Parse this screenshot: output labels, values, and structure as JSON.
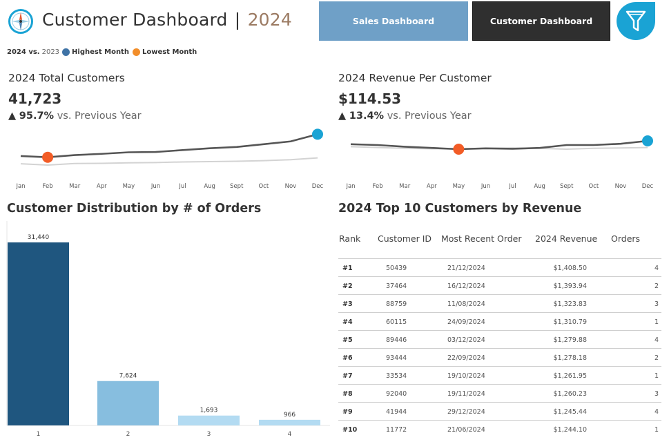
{
  "header": {
    "title": "Customer Dashboard",
    "separator": "|",
    "year": "2024",
    "nav_sales": "Sales Dashboard",
    "nav_customer": "Customer Dashboard",
    "filter_icon": "filter-icon",
    "logo_icon": "compass-icon"
  },
  "legend": {
    "current": "2024 vs.",
    "previous": "2023",
    "highest": "Highest Month",
    "lowest": "Lowest Month",
    "highest_color": "#3f73a6",
    "lowest_color": "#f28e2b"
  },
  "kpi_customers": {
    "label": "2024 Total Customers",
    "value": "41,723",
    "change_arrow": "▲",
    "change_pct": "95.7%",
    "change_text": "vs. Previous Year"
  },
  "kpi_revenue": {
    "label": "2024 Revenue Per Customer",
    "value": "$114.53",
    "change_arrow": "▲",
    "change_pct": "13.4%",
    "change_text": "vs. Previous Year"
  },
  "distribution": {
    "title": "Customer Distribution by # of Orders"
  },
  "top10": {
    "title": "2024 Top 10 Customers by Revenue",
    "columns": [
      "Rank",
      "Customer ID",
      "Most Recent Order",
      "2024 Revenue",
      "Orders"
    ],
    "rows": [
      {
        "rank": "#1",
        "id": "50439",
        "date": "21/12/2024",
        "revenue": "$1,408.50",
        "orders": "4"
      },
      {
        "rank": "#2",
        "id": "37464",
        "date": "16/12/2024",
        "revenue": "$1,393.94",
        "orders": "2"
      },
      {
        "rank": "#3",
        "id": "88759",
        "date": "11/08/2024",
        "revenue": "$1,323.83",
        "orders": "3"
      },
      {
        "rank": "#4",
        "id": "60115",
        "date": "24/09/2024",
        "revenue": "$1,310.79",
        "orders": "1"
      },
      {
        "rank": "#5",
        "id": "89446",
        "date": "03/12/2024",
        "revenue": "$1,279.88",
        "orders": "4"
      },
      {
        "rank": "#6",
        "id": "93444",
        "date": "22/09/2024",
        "revenue": "$1,278.18",
        "orders": "2"
      },
      {
        "rank": "#7",
        "id": "33534",
        "date": "19/10/2024",
        "revenue": "$1,261.95",
        "orders": "1"
      },
      {
        "rank": "#8",
        "id": "92040",
        "date": "19/11/2024",
        "revenue": "$1,260.23",
        "orders": "3"
      },
      {
        "rank": "#9",
        "id": "41944",
        "date": "29/12/2024",
        "revenue": "$1,245.44",
        "orders": "4"
      },
      {
        "rank": "#10",
        "id": "11772",
        "date": "21/06/2024",
        "revenue": "$1,244.10",
        "orders": "1"
      }
    ]
  },
  "chart_data": [
    {
      "type": "line",
      "x": [
        "Jan",
        "Feb",
        "Mar",
        "Apr",
        "May",
        "Jun",
        "Jul",
        "Aug",
        "Sept",
        "Oct",
        "Nov",
        "Dec"
      ],
      "series": [
        {
          "values": [
            2900,
            2700,
            3050,
            3250,
            3500,
            3550,
            3850,
            4150,
            4350,
            4800,
            5250,
            6400
          ],
          "color": "#555555"
        },
        {
          "values": [
            1650,
            1450,
            1700,
            1720,
            1800,
            1850,
            1950,
            2000,
            2050,
            2150,
            2300,
            2600
          ],
          "color": "#d3d3d3"
        }
      ],
      "highest_index": 11,
      "lowest_index": 1,
      "highest_color": "#1aa3d4",
      "lowest_color": "#f25c26",
      "ylim": [
        0,
        8000
      ],
      "xlabel": "",
      "ylabel": ""
    },
    {
      "type": "line",
      "x": [
        "Jan",
        "Feb",
        "Mar",
        "Apr",
        "May",
        "Jun",
        "Jul",
        "Aug",
        "Sept",
        "Oct",
        "Nov",
        "Dec"
      ],
      "series": [
        {
          "values": [
            116,
            115,
            113,
            111.5,
            110,
            111,
            110.5,
            111.5,
            115,
            115,
            116.5,
            120
          ],
          "color": "#555555"
        },
        {
          "values": [
            113,
            112,
            111,
            110.5,
            110.5,
            111,
            111.5,
            111,
            110,
            111,
            111.5,
            112
          ],
          "color": "#d3d3d3"
        }
      ],
      "highest_index": 11,
      "lowest_index": 4,
      "highest_color": "#1aa3d4",
      "lowest_color": "#f25c26",
      "ylim": [
        80,
        140
      ],
      "xlabel": "",
      "ylabel": ""
    },
    {
      "type": "bar",
      "title": "Customer Distribution by # of Orders",
      "categories": [
        "1",
        "2",
        "3",
        "4"
      ],
      "values": [
        31440,
        7624,
        1693,
        966
      ],
      "value_labels": [
        "31,440",
        "7,624",
        "1,693",
        "966"
      ],
      "colors": [
        "#1f567f",
        "#87bedf",
        "#b3dbf2",
        "#b3dbf2"
      ],
      "ylim": [
        0,
        34000
      ],
      "xlabel": "",
      "ylabel": ""
    }
  ]
}
